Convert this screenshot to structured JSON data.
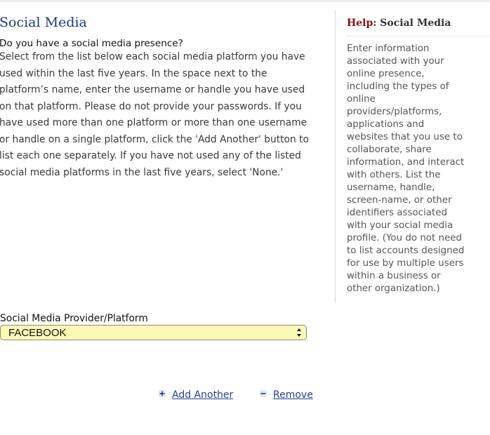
{
  "form": {
    "title": "Social Media",
    "question": "Do you have a social media presence?",
    "instructions": [
      "Select from the list below each social media platform you have",
      "used within the last five years. In the space next to the",
      "platform’s name, enter the username or handle you have used",
      "on that platform. Please do not provide your passwords. If you",
      "have used more than one platform or more than one username",
      "or handle on a single platform, click the 'Add Another' button to",
      "list each one separately. If you have not used any of the listed",
      "social media platforms in the last five years, select 'None.'"
    ],
    "field_label": "Social Media Provider/Platform",
    "selected_platform": "FACEBOOK",
    "add_label": "Add Another",
    "remove_label": "Remove"
  },
  "help": {
    "label": "Help:",
    "topic": "Social Media",
    "body_lines": [
      "Enter information",
      "associated with your",
      "online presence,",
      "including the types of",
      "online",
      "providers/platforms,",
      "applications and",
      "websites that you use to",
      "collaborate, share",
      "information, and interact",
      "with others. List the",
      "username, handle,",
      "screen-name, or other",
      "identifiers associated",
      "with your social media",
      "profile. (You do not need",
      "to list accounts designed",
      "for use by multiple users",
      "within a business or",
      "other organization.)"
    ]
  },
  "icons": {
    "add": "plus-icon",
    "remove": "minus-icon",
    "select": "chevron-up-down-icon"
  },
  "colors": {
    "title": "#1e3b7a",
    "help_label": "#8b1010",
    "link": "#1f3f8c",
    "select_background": "#fbf9b8"
  }
}
